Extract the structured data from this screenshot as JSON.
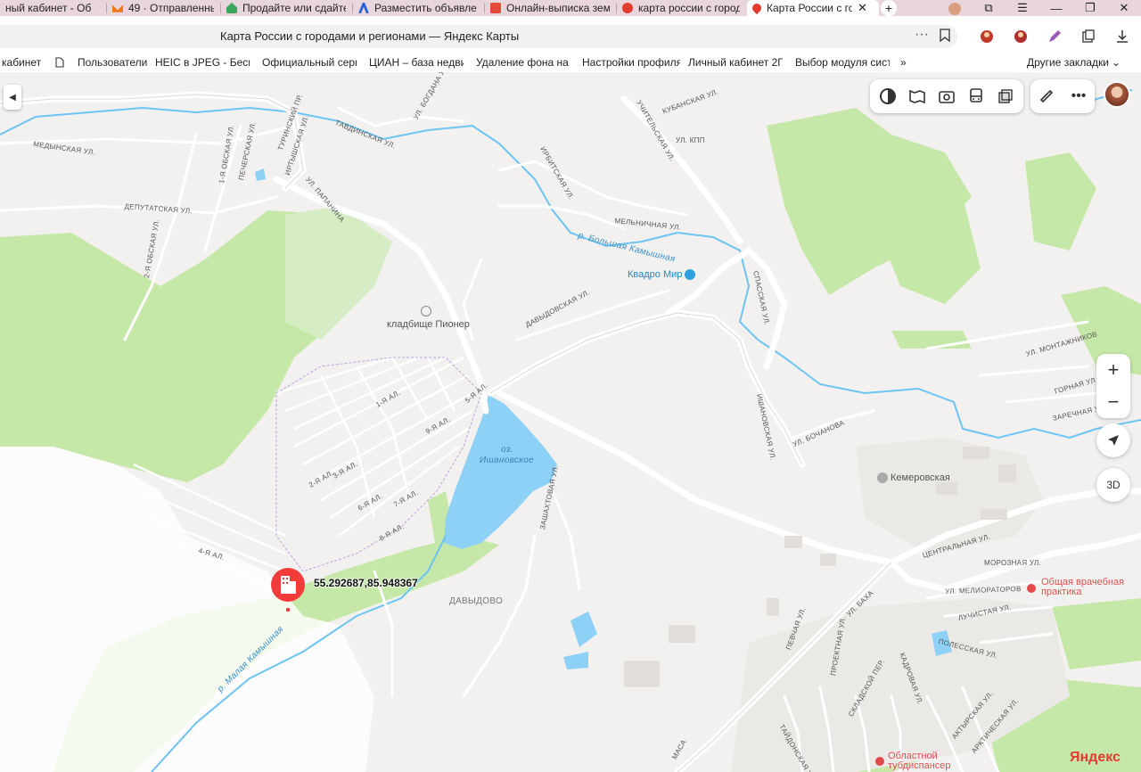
{
  "browser": {
    "tabs": [
      {
        "label": "ный кабинет - Об",
        "icon": "page-icon",
        "color": "#d9a85a"
      },
      {
        "label": "49 · Отправленные –",
        "icon": "mail-icon",
        "color": "#f07a1a"
      },
      {
        "label": "Продайте или сдайте",
        "icon": "house-icon",
        "color": "#3aa55d"
      },
      {
        "label": "Разместить объявле",
        "icon": "avito-icon",
        "color": "#2a62d8"
      },
      {
        "label": "Онлайн-выписка зем",
        "icon": "document-icon",
        "color": "#e44a3a"
      },
      {
        "label": "карта россии с город",
        "icon": "yandex-icon",
        "color": "#e33b2e"
      },
      {
        "label": "Карта России с гор",
        "icon": "map-pin-icon",
        "color": "#e33b2e"
      }
    ],
    "page_title": "Карта России с городами и регионами — Яндекс Карты",
    "bookmarks": [
      "кабинет",
      "Пользователи",
      "HEIC в JPEG - Беспла",
      "Официальный серви",
      "ЦИАН – база недвиж",
      "Удаление фона на и",
      "Настройки профиля",
      "Личный кабинет 2ГИ",
      "Выбор модуля систе",
      "»",
      "Другие закладки"
    ]
  },
  "map": {
    "streets": [
      "ТУРИНСКИЙ ПР.",
      "ИРТЫШСКАЯ УЛ.",
      "ТАВДИНСКАЯ УЛ.",
      "УЛ. БОГДАНА ХМ.",
      "УЧИТЕЛЬСКАЯ УЛ.",
      "КУБАНСКАЯ УЛ.",
      "УЛ. КПП",
      "МЕДЫНСКАЯ УЛ.",
      "1-Я ОБСКАЯ УЛ.",
      "ПЕЧЕРСКАЯ УЛ.",
      "ИРБИТСКАЯ УЛ.",
      "УЛ. ПАПАНИНА",
      "ДЕПУТАТСКАЯ УЛ.",
      "МЕЛЬНИЧНАЯ УЛ.",
      "2-Я ОБСКАЯ УЛ.",
      "ДАВЫДОВСКАЯ УЛ.",
      "СПАССКАЯ УЛ.",
      "ИШАНОВСКАЯ УЛ.",
      "УЛ. МОНТАЖНИКОВ",
      "ГОРНАЯ УЛ.",
      "ЗАРЕЧНАЯ УЛ.",
      "УЛ. БОЧАНОВА",
      "ЗАШАХТОВАЯ УЛ.",
      "ЦЕНТРАЛЬНАЯ УЛ.",
      "МОРОЗНАЯ УЛ.",
      "УЛ. МЕЛИОРАТОРОВ",
      "ЛУЧИСТАЯ УЛ.",
      "ПОЛЕССКАЯ УЛ.",
      "УЛ. БАХА",
      "ПЕВЧАЯ УЛ.",
      "АКТЫРСКАЯ УЛ.",
      "КАДРОВАЯ УЛ.",
      "АРКТИЧЕСКАЯ УЛ.",
      "ТАЙДОНСКАЯ УЛ.",
      "ПРОЕКТНАЯ УЛ.",
      "СКЛАДСКОЙ ПЕР.",
      "МАСА"
    ],
    "water": {
      "river1": "р. Большая Камышная",
      "river2": "р. Малая Камышная",
      "lake_line1": "оз.",
      "lake_line2": "Ишановское"
    },
    "pois": {
      "kvadro": "Квадро Мир",
      "cemetery": "кладбище Пионер",
      "kemerovskaya": "Кемеровская",
      "clinic_line1": "Общая врачебная",
      "clinic_line2": "практика",
      "tb_line1": "Областной",
      "tb_line2": "тубдиспансер",
      "district": "ДАВЫДОВО"
    },
    "alleys": [
      "1-Я АЛ.",
      "2-Я АЛ.",
      "3-Я АЛ.",
      "4-Я АЛ.",
      "5-Я АЛ.",
      "6-Я АЛ.",
      "7-Я АЛ.",
      "8-Я АЛ.",
      "9-Я АЛ."
    ],
    "marker_coords": "55.292687,85.948367",
    "brand": "Яндекс",
    "controls": {
      "three_d": "3D",
      "zoom_in": "+",
      "zoom_out": "−"
    },
    "colors": {
      "forest": "#c5e8a8",
      "water": "#8ed1f7",
      "road": "#ffffff",
      "marker": "#f43b3b"
    }
  }
}
